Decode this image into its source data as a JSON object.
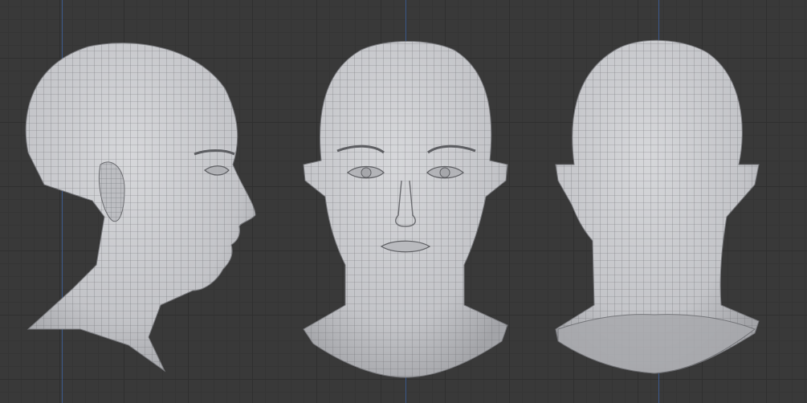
{
  "viewport": {
    "views": [
      {
        "id": "side",
        "icon": "head-side-view-icon"
      },
      {
        "id": "front",
        "icon": "head-front-view-icon"
      },
      {
        "id": "back",
        "icon": "head-back-view-icon"
      }
    ],
    "colors": {
      "background": "#393939",
      "grid_minor": "#353535",
      "grid_major": "#2f2f2f",
      "axis": "#3d5f9a",
      "mesh_fill": "#c9cacd",
      "mesh_shadow": "#9a9b9f",
      "wire": "#6b6c70"
    }
  }
}
